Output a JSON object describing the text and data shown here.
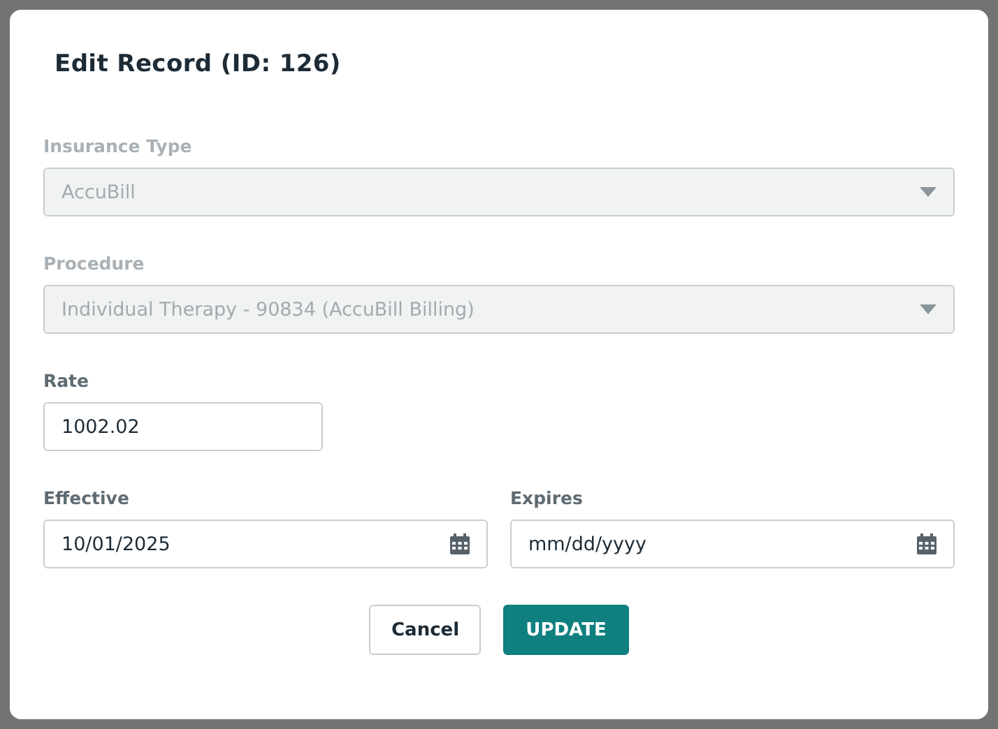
{
  "dialog": {
    "title": "Edit Record (ID: 126)",
    "rows": [
      [
        {
          "kind": "select",
          "label": "Insurance Type",
          "value": "AccuBill",
          "disabled": true
        }
      ],
      [
        {
          "kind": "select",
          "label": "Procedure",
          "value": "Individual Therapy - 90834 (AccuBill Billing)",
          "disabled": true
        }
      ],
      [
        {
          "kind": "text",
          "label": "Rate",
          "value": "1002.02",
          "disabled": false
        }
      ],
      [
        {
          "kind": "date",
          "label": "Effective",
          "value": "10/01/2025",
          "disabled": false
        },
        {
          "kind": "date",
          "label": "Expires",
          "placeholder": "mm/dd/yyyy",
          "disabled": false
        }
      ]
    ],
    "buttons": [
      {
        "kind": "secondary",
        "label": "Cancel"
      },
      {
        "kind": "primary",
        "label": "UPDATE"
      }
    ]
  }
}
